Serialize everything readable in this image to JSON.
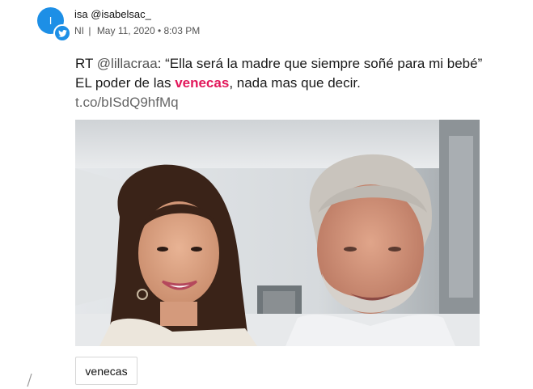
{
  "author": {
    "avatar_letter": "I",
    "display": "isa @isabelsac_"
  },
  "meta": {
    "region": "NI",
    "separator": "|",
    "datetime": "May 11, 2020 • 8:03 PM"
  },
  "tweet": {
    "prefix": "RT ",
    "mention": "@lillacraa",
    "part1": ": “Ella será la madre que siempre soñé para mi bebé” EL poder de las ",
    "highlight": "venecas",
    "part2": ", nada mas que decir.",
    "link": "t.co/bISdQ9hfMq"
  },
  "tag": {
    "label": "venecas"
  },
  "colors": {
    "accent": "#1d8fe6",
    "highlight": "#e2185b"
  },
  "icons": {
    "badge": "twitter-bird-icon"
  }
}
